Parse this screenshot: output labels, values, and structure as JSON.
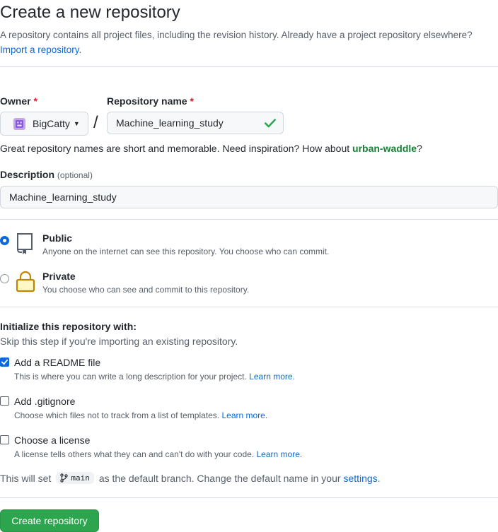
{
  "header": {
    "title": "Create a new repository",
    "intro": "A repository contains all project files, including the revision history. Already have a project repository elsewhere?",
    "import_link": "Import a repository."
  },
  "owner": {
    "label": "Owner",
    "required_mark": "*",
    "value": "BigCatty"
  },
  "repo_name": {
    "label": "Repository name",
    "required_mark": "*",
    "value": "Machine_learning_study",
    "separator": "/"
  },
  "name_hint": {
    "text": "Great repository names are short and memorable. Need inspiration? How about ",
    "suggestion": "urban-waddle",
    "suffix": "?"
  },
  "description": {
    "label": "Description",
    "optional": "(optional)",
    "value": "Machine_learning_study"
  },
  "visibility": {
    "options": [
      {
        "title": "Public",
        "desc": "Anyone on the internet can see this repository. You choose who can commit.",
        "selected": true,
        "icon": "repo-icon"
      },
      {
        "title": "Private",
        "desc": "You choose who can see and commit to this repository.",
        "selected": false,
        "icon": "lock-icon"
      }
    ]
  },
  "init": {
    "heading": "Initialize this repository with:",
    "sub": "Skip this step if you're importing an existing repository.",
    "items": [
      {
        "title": "Add a README file",
        "desc": "This is where you can write a long description for your project.",
        "link": "Learn more.",
        "checked": true
      },
      {
        "title": "Add .gitignore",
        "desc": "Choose which files not to track from a list of templates.",
        "link": "Learn more.",
        "checked": false
      },
      {
        "title": "Choose a license",
        "desc": "A license tells others what they can and can't do with your code.",
        "link": "Learn more.",
        "checked": false
      }
    ]
  },
  "branch": {
    "prefix": "This will set",
    "name": "main",
    "middle": "as the default branch. Change the default name in your",
    "settings_link": "settings",
    "suffix": "."
  },
  "submit": {
    "label": "Create repository"
  },
  "colors": {
    "accent": "#0969da",
    "success": "#2da44e",
    "danger": "#cf222e",
    "suggestion": "#1a7f37"
  }
}
